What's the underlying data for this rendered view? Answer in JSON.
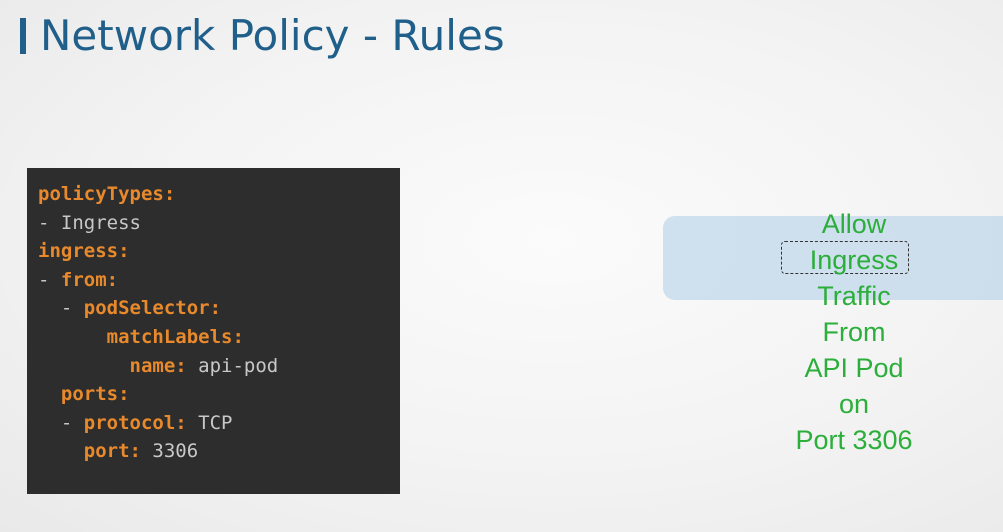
{
  "title": "Network Policy - Rules",
  "code": {
    "l1_key": "policyTypes:",
    "l2_val": "- Ingress",
    "l3_key": "ingress:",
    "l4_dash": "- ",
    "l4_key": "from:",
    "l5_dash": "  - ",
    "l5_key": "podSelector:",
    "l6_key": "      matchLabels:",
    "l7_key": "        name:",
    "l7_val": " api-pod",
    "l8_key": "  ports:",
    "l9_dash": "  - ",
    "l9_key": "protocol:",
    "l9_val": " TCP",
    "l10_key": "    port:",
    "l10_val": " 3306"
  },
  "rule": {
    "lines": [
      "Allow",
      "Ingress",
      "Traffic",
      "From",
      "API Pod",
      "on",
      "Port 3306"
    ]
  },
  "colors": {
    "title": "#1f5f8a",
    "code_background": "#2d2d2d",
    "code_key": "#e8892b",
    "code_value": "#c8c8c8",
    "rule_text": "#2cae3a",
    "highlight": "#adcce6"
  }
}
